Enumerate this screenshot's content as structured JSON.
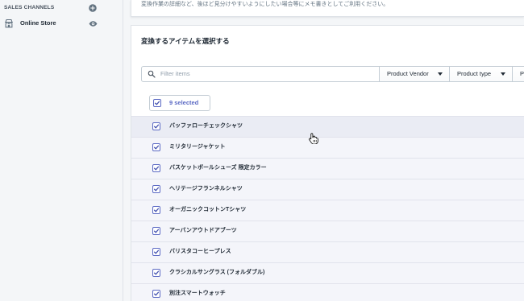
{
  "sidebar": {
    "section_title": "SALES CHANNELS",
    "section_add_icon": "plus-circle-icon",
    "items": [
      {
        "label": "Online Store",
        "icon": "store-icon",
        "action_icon": "eye-icon"
      }
    ]
  },
  "notes_card": {
    "help_text": "変換作業の詳細など、後ほど見分けやすいようにしたい場合等にメモ書きとしてご利用ください。"
  },
  "items_card": {
    "title": "変換するアイテムを選択する",
    "search": {
      "placeholder": "Filter items",
      "icon": "search-icon"
    },
    "filter_buttons": [
      {
        "label": "Product Vendor",
        "icon": "caret-down-icon"
      },
      {
        "label": "Product type",
        "icon": "caret-down-icon"
      },
      {
        "label": "P"
      }
    ],
    "bulk_select": {
      "label": "9 selected",
      "checked": true
    },
    "items": [
      {
        "label": "バッファローチェックシャツ",
        "checked": true,
        "hovered": true
      },
      {
        "label": "ミリタリージャケット",
        "checked": true
      },
      {
        "label": "バスケットボールシューズ 限定カラー",
        "checked": true
      },
      {
        "label": "ヘリテージフランネルシャツ",
        "checked": true
      },
      {
        "label": "オーガニックコットンTシャツ",
        "checked": true
      },
      {
        "label": "アーバンアウトドアブーツ",
        "checked": true
      },
      {
        "label": "バリスタコーヒープレス",
        "checked": true
      },
      {
        "label": "クラシカルサングラス (フォルダブル)",
        "checked": true
      },
      {
        "label": "別注スマートウォッチ",
        "checked": true
      }
    ]
  },
  "cursor": {
    "icon": "hand-pointer-icon"
  },
  "colors": {
    "accent": "#5c6ac4",
    "text": "#212b36",
    "muted_text": "#637381",
    "selected_row": "#f4f5fa",
    "hovered_row": "#eaecf4",
    "control_border": "#c4cdd5"
  }
}
